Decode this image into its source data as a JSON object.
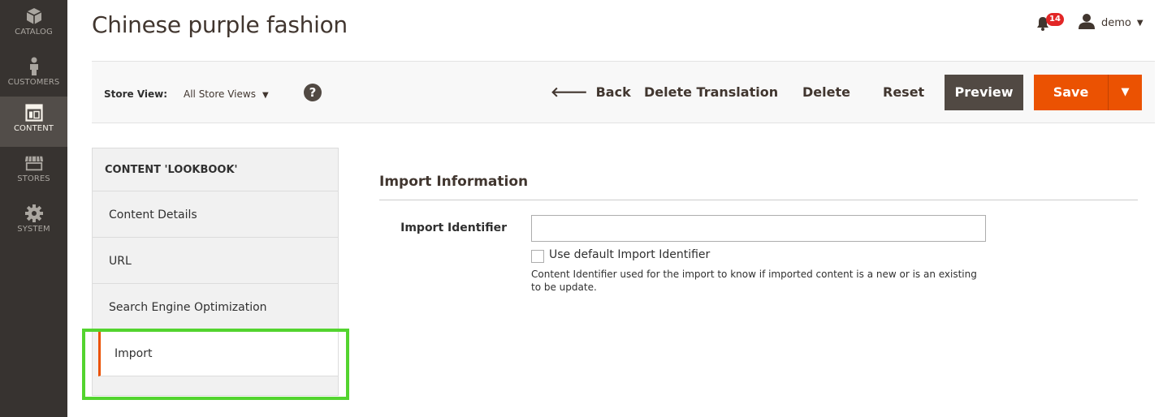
{
  "nav": {
    "items": [
      {
        "label": "CATALOG",
        "icon": "box-icon"
      },
      {
        "label": "CUSTOMERS",
        "icon": "person-icon"
      },
      {
        "label": "CONTENT",
        "icon": "layout-icon",
        "active": true
      },
      {
        "label": "STORES",
        "icon": "storefront-icon"
      },
      {
        "label": "SYSTEM",
        "icon": "gear-icon"
      }
    ]
  },
  "header": {
    "title": "Chinese purple fashion",
    "notifications_count": "14",
    "user_name": "demo"
  },
  "toolbar": {
    "store_view_label": "Store View:",
    "store_view_value": "All Store Views",
    "help_label": "?",
    "back_label": "Back",
    "delete_translation_label": "Delete Translation",
    "delete_label": "Delete",
    "reset_label": "Reset",
    "preview_label": "Preview",
    "save_label": "Save"
  },
  "sidebar": {
    "title": "CONTENT 'LOOKBOOK'",
    "tabs": [
      {
        "label": "Content Details"
      },
      {
        "label": "URL"
      },
      {
        "label": "Search Engine Optimization"
      },
      {
        "label": "Import",
        "active": true
      }
    ]
  },
  "main": {
    "section_title": "Import Information",
    "import_identifier_label": "Import Identifier",
    "import_identifier_value": "",
    "use_default_label": "Use default Import Identifier",
    "use_default_checked": false,
    "note": "Content Identifier used for the import to know if imported content is a new or is an existing to be update."
  },
  "colors": {
    "nav_bg": "#373330",
    "accent": "#eb5202",
    "highlight": "#53d42f"
  }
}
